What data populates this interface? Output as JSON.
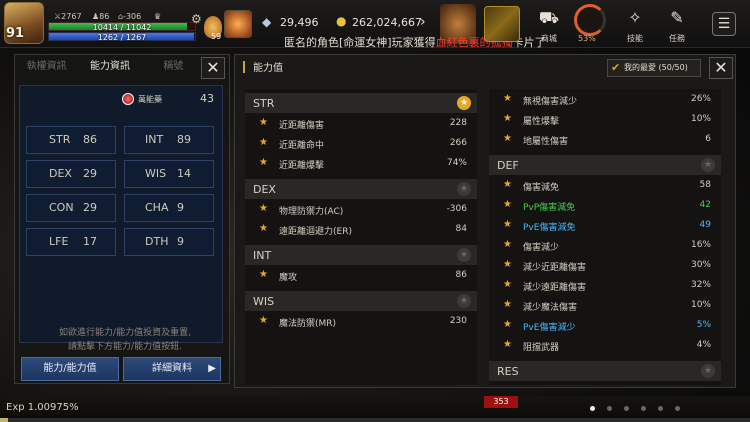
{
  "hud": {
    "level": "91",
    "stat_a": "2767",
    "stat_b": "86",
    "stat_c": "-306",
    "hp_text": "10414 / 11042",
    "hp_fraction": 0.943,
    "mp_text": "1262 / 1267",
    "mp_fraction": 0.996,
    "potion_count": "59",
    "crystals": "29,496",
    "gold": "262,024,667",
    "ticker_before": "匿名的角色[命運女神]玩家獲得",
    "ticker_red": "血紅色裏的孤獨",
    "ticker_after": "卡片了",
    "menu": [
      {
        "label": "商城",
        "icon": "shop-icon"
      },
      {
        "label": "",
        "icon": "progress-ring"
      },
      {
        "label": "技能",
        "icon": "skill-icon"
      },
      {
        "label": "任務",
        "icon": "quest-icon"
      }
    ],
    "progress_pct": "53%"
  },
  "left_panel": {
    "tabs": [
      "執權資訊",
      "能力資訊",
      "稱號"
    ],
    "active_tab": 1,
    "all_label": "萬能藥",
    "all_value": "43",
    "stats": [
      {
        "key": "STR",
        "value": "86"
      },
      {
        "key": "INT",
        "value": "89"
      },
      {
        "key": "DEX",
        "value": "29"
      },
      {
        "key": "WIS",
        "value": "14"
      },
      {
        "key": "CON",
        "value": "29"
      },
      {
        "key": "CHA",
        "value": "9"
      },
      {
        "key": "LFE",
        "value": "17"
      },
      {
        "key": "DTH",
        "value": "9"
      }
    ],
    "hint_line1": "如欲進行能力/能力值投資及重置,",
    "hint_line2": "請點擊下方能力/能力值按鈕.",
    "button_ability": "能力/能力值",
    "button_details": "詳細資料"
  },
  "right_panel": {
    "title": "能力值",
    "favorites": "我的最愛 (50/50)",
    "left_sections": [
      {
        "name": "STR",
        "badge_on": true,
        "rows": [
          {
            "label": "近距離傷害",
            "value": "228"
          },
          {
            "label": "近距離命中",
            "value": "266"
          },
          {
            "label": "近距離爆擊",
            "value": "74%"
          }
        ]
      },
      {
        "name": "DEX",
        "badge_on": false,
        "rows": [
          {
            "label": "物理防禦力(AC)",
            "value": "-306"
          },
          {
            "label": "遠距離迴避力(ER)",
            "value": "84"
          }
        ]
      },
      {
        "name": "INT",
        "badge_on": false,
        "rows": [
          {
            "label": "魔攻",
            "value": "86"
          }
        ]
      },
      {
        "name": "WIS",
        "badge_on": false,
        "rows": [
          {
            "label": "魔法防禦(MR)",
            "value": "230"
          }
        ]
      }
    ],
    "right_top_rows": [
      {
        "label": "無視傷害減少",
        "value": "26%"
      },
      {
        "label": "屬性爆擊",
        "value": "10%"
      },
      {
        "label": "地屬性傷害",
        "value": "6"
      }
    ],
    "right_sections": [
      {
        "name": "DEF",
        "badge_on": false,
        "rows": [
          {
            "label": "傷害減免",
            "value": "58",
            "color": ""
          },
          {
            "label": "PvP傷害減免",
            "value": "42",
            "color": "green"
          },
          {
            "label": "PvE傷害減免",
            "value": "49",
            "color": "cyan"
          },
          {
            "label": "傷害減少",
            "value": "16%",
            "color": ""
          },
          {
            "label": "減少近距離傷害",
            "value": "30%",
            "color": ""
          },
          {
            "label": "減少遠距離傷害",
            "value": "32%",
            "color": ""
          },
          {
            "label": "減少魔法傷害",
            "value": "10%",
            "color": ""
          },
          {
            "label": "PvE傷害減少",
            "value": "5%",
            "color": "cyan"
          },
          {
            "label": "阻擋武器",
            "value": "4%",
            "color": ""
          }
        ]
      },
      {
        "name": "RES",
        "badge_on": false,
        "rows": []
      }
    ]
  },
  "bottom": {
    "exp": "Exp 1.00975%",
    "exp_fraction": 0.01,
    "badge": "353"
  }
}
